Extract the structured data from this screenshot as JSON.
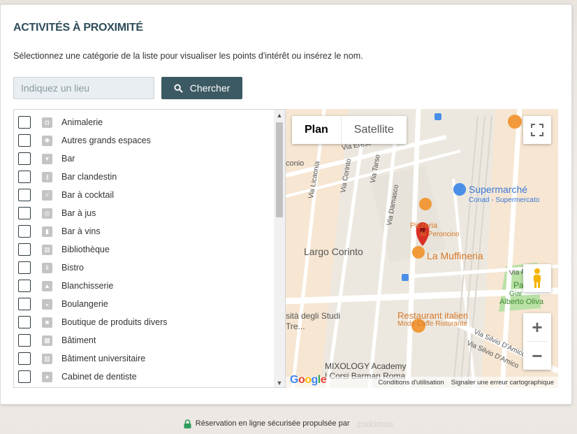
{
  "header": {
    "title": "ACTIVITÉS À PROXIMITÉ",
    "subtitle": "Sélectionnez une catégorie de la liste pour visualiser les points d'intérêt ou insérez le nom."
  },
  "search": {
    "placeholder": "Indiquez un lieu",
    "button_label": "Chercher"
  },
  "categories": [
    {
      "label": "Animalerie",
      "checked": false
    },
    {
      "label": "Autres grands espaces",
      "checked": false
    },
    {
      "label": "Bar",
      "checked": false
    },
    {
      "label": "Bar clandestin",
      "checked": false
    },
    {
      "label": "Bar à cocktail",
      "checked": false
    },
    {
      "label": "Bar à jus",
      "checked": false
    },
    {
      "label": "Bar à vins",
      "checked": false
    },
    {
      "label": "Bibliothèque",
      "checked": false
    },
    {
      "label": "Bistro",
      "checked": false
    },
    {
      "label": "Blanchisserie",
      "checked": false
    },
    {
      "label": "Boulangerie",
      "checked": false
    },
    {
      "label": "Boutique de produits divers",
      "checked": false
    },
    {
      "label": "Bâtiment",
      "checked": false
    },
    {
      "label": "Bâtiment universitaire",
      "checked": false
    },
    {
      "label": "Cabinet de dentiste",
      "checked": false
    }
  ],
  "map": {
    "type_plan": "Plan",
    "type_satellite": "Satellite",
    "active_type": "Plan",
    "zoom_in": "+",
    "zoom_out": "−",
    "labels": {
      "via_ereso": "Via Ereso",
      "conio": "conio",
      "via_licaonia": "Via Licaonia",
      "via_corinto": "Via Corinto",
      "via_tarso": "Via Tarso",
      "via_damasco": "Via Damasco",
      "supermarche": "Supermarché",
      "conad": "Conad - Supermercato",
      "pizzeria_1": "Pizzeria",
      "pizzeria_2": "Al Peroncino",
      "largo_corinto": "Largo Corinto",
      "la_muffineria": "La Muffineria",
      "via_apia": "Via Apia",
      "pa": "Pa",
      "giar": "Giar",
      "alberto_oliva": "Alberto Oliva",
      "sita_1": "sità degli Studi",
      "sita_2": "Tre...",
      "restaurant": "Restaurant italien",
      "modo": "Modo Caffe Ristorante",
      "mixology_1": "MIXOLOGY Academy",
      "mixology_2": "| Corsi Barman Roma",
      "via_silvio_1": "Via Silvio D'Amico",
      "via_silvio_2": "Via Silvio D'Amico"
    },
    "google": "Google",
    "terms": "Conditions d'utilisation",
    "report": "Signaler une erreur cartographique"
  },
  "footer": {
    "note": "Réservation en ligne sécurisée propulsée par",
    "brand": "zodomus"
  },
  "colors": {
    "title": "#2f4d5a",
    "button": "#3c5a63",
    "marker": "#d93025",
    "poi_orange": "#f29a3b",
    "poi_blue": "#4a8fe7",
    "park": "#b9e0a5"
  }
}
